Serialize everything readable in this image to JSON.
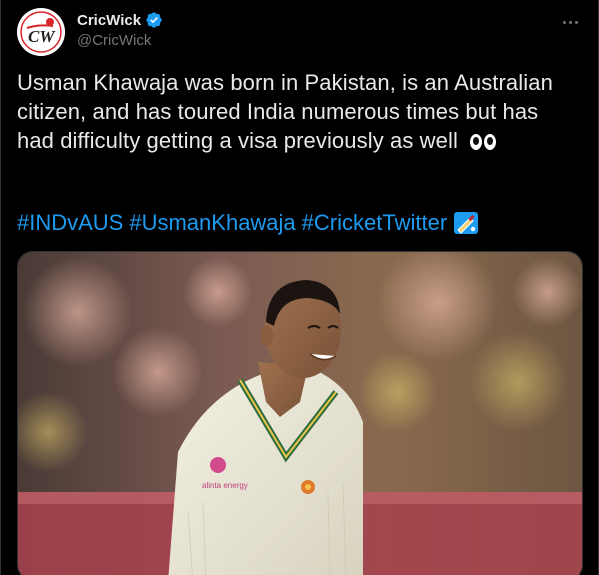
{
  "account": {
    "display_name": "CricWick",
    "handle": "@CricWick",
    "verified": true,
    "avatar_logo_text": "CW"
  },
  "tweet": {
    "text": "Usman Khawaja was born in Pakistan, is an Australian citizen, and has toured India numerous times but has had difficulty getting a visa previously as well",
    "hashtags": [
      "#INDvAUS",
      "#UsmanKhawaja",
      "#CricketTwitter"
    ],
    "emojis": [
      "eyes-icon",
      "cricket-bat-icon"
    ]
  },
  "media": {
    "jersey_sponsor_text": "alinta energy",
    "description_icon": "cricketer-photo"
  },
  "colors": {
    "background": "#000000",
    "text": "#e7e9ea",
    "muted": "#71767b",
    "link": "#1d9bf0",
    "verified": "#1d9bf0",
    "brand_red": "#d9252a"
  }
}
